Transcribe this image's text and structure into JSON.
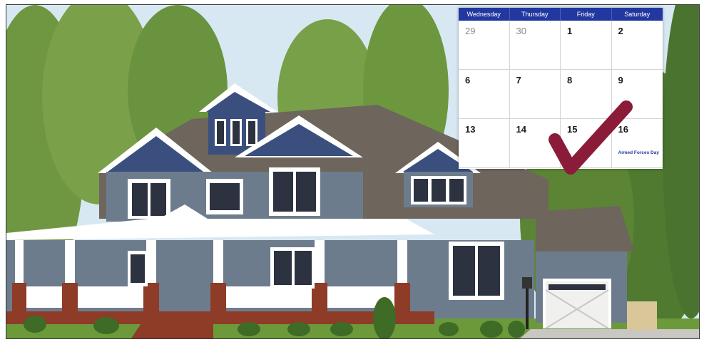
{
  "calendar": {
    "days": [
      "Wednesday",
      "Thursday",
      "Friday",
      "Saturday"
    ],
    "weeks": [
      [
        {
          "n": "29",
          "muted": true
        },
        {
          "n": "30",
          "muted": true
        },
        {
          "n": "1",
          "muted": false
        },
        {
          "n": "2",
          "muted": false
        }
      ],
      [
        {
          "n": "6",
          "muted": false
        },
        {
          "n": "7",
          "muted": false
        },
        {
          "n": "8",
          "muted": false
        },
        {
          "n": "9",
          "muted": false
        }
      ],
      [
        {
          "n": "13",
          "muted": false
        },
        {
          "n": "14",
          "muted": false
        },
        {
          "n": "15",
          "muted": false
        },
        {
          "n": "16",
          "muted": false
        }
      ]
    ],
    "note": "Armed Forces Day",
    "header_color": "#2238a0",
    "checkmark_color": "#8a1c3a"
  }
}
